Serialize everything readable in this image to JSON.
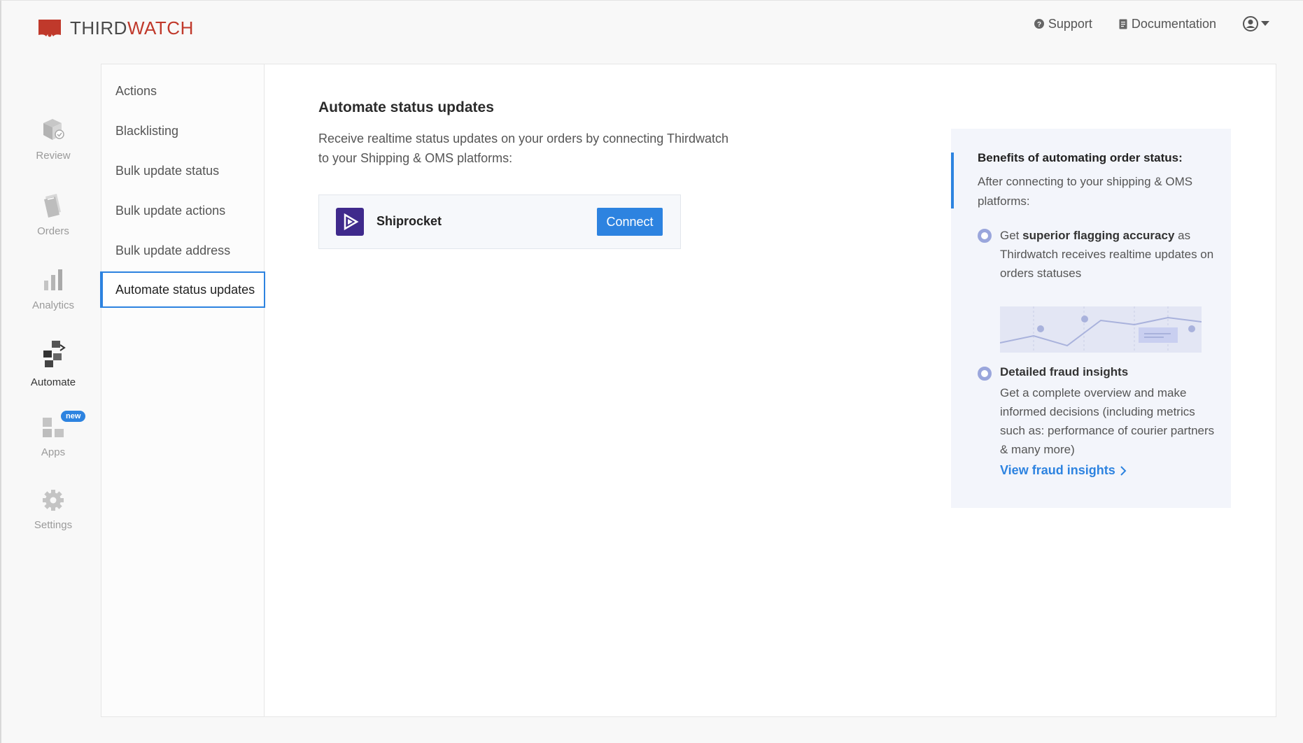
{
  "brand": {
    "name_part1": "THIRD",
    "name_part2": "WATCH",
    "logo_color": "#c0392b"
  },
  "header": {
    "support_label": "Support",
    "docs_label": "Documentation",
    "user_icon": "user-circle-icon"
  },
  "leftnav": {
    "items": [
      {
        "label": "Review",
        "icon": "box-check-icon"
      },
      {
        "label": "Orders",
        "icon": "orders-stack-icon"
      },
      {
        "label": "Analytics",
        "icon": "bar-chart-icon"
      },
      {
        "label": "Automate",
        "icon": "automate-flow-icon"
      },
      {
        "label": "Apps",
        "icon": "apps-grid-icon",
        "badge": "new"
      },
      {
        "label": "Settings",
        "icon": "gear-icon"
      }
    ],
    "active": "Automate"
  },
  "subnav": {
    "items": [
      {
        "label": "Actions"
      },
      {
        "label": "Blacklisting"
      },
      {
        "label": "Bulk update status"
      },
      {
        "label": "Bulk update actions"
      },
      {
        "label": "Bulk update address"
      },
      {
        "label": "Automate status updates"
      }
    ],
    "active": "Automate status updates"
  },
  "main": {
    "title": "Automate status updates",
    "description": "Receive realtime status updates on your orders by connecting Thirdwatch to your Shipping & OMS platforms:",
    "integration": {
      "name": "Shiprocket",
      "button_label": "Connect"
    }
  },
  "benefits": {
    "title": "Benefits of automating order status:",
    "subtitle": "After connecting to your shipping & OMS platforms:",
    "point1": {
      "prefix": "Get ",
      "bold": "superior flagging accuracy",
      "suffix": " as Thirdwatch receives realtime updates on orders statuses"
    },
    "point2": {
      "heading": "Detailed fraud insights",
      "body": "Get a complete overview and make informed decisions (including metrics such as: performance of courier partners & many more)"
    },
    "link_label": "View fraud insights"
  },
  "colors": {
    "accent": "#2d83e0",
    "brand_red": "#c0392b",
    "bullet": "#9aa6dc",
    "benefits_bg": "#f3f5fb"
  }
}
